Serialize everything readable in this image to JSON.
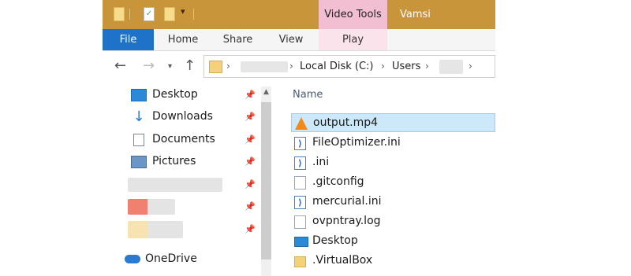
{
  "title_bar": {
    "contextual_tab": "Video Tools",
    "window_title": "Vamsi"
  },
  "ribbon": {
    "tabs": [
      "File",
      "Home",
      "Share",
      "View",
      "Play"
    ]
  },
  "address_bar": {
    "crumbs": [
      "Local Disk (C:)",
      "Users"
    ],
    "separator": "›"
  },
  "nav_pane": {
    "items": [
      {
        "label": "Desktop",
        "icon": "desktop-icon"
      },
      {
        "label": "Downloads",
        "icon": "downloads-icon"
      },
      {
        "label": "Documents",
        "icon": "documents-icon"
      },
      {
        "label": "Pictures",
        "icon": "pictures-icon"
      }
    ],
    "onedrive": "OneDrive"
  },
  "file_list": {
    "column_header": "Name",
    "files": [
      {
        "name": "output.mp4",
        "icon": "vlc-icon",
        "selected": true
      },
      {
        "name": "FileOptimizer.ini",
        "icon": "vscode-file-icon"
      },
      {
        "name": ".ini",
        "icon": "vscode-file-icon"
      },
      {
        "name": ".gitconfig",
        "icon": "document-icon"
      },
      {
        "name": "mercurial.ini",
        "icon": "vscode-file-icon"
      },
      {
        "name": "ovpntray.log",
        "icon": "document-icon"
      },
      {
        "name": "Desktop",
        "icon": "desktop-folder-icon"
      },
      {
        "name": ".VirtualBox",
        "icon": "folder-icon"
      }
    ]
  },
  "colors": {
    "title_bar": "#c8953a",
    "contextual_tab": "#f2bed2",
    "file_tab": "#1e73c8",
    "selection": "#cde8f8"
  }
}
